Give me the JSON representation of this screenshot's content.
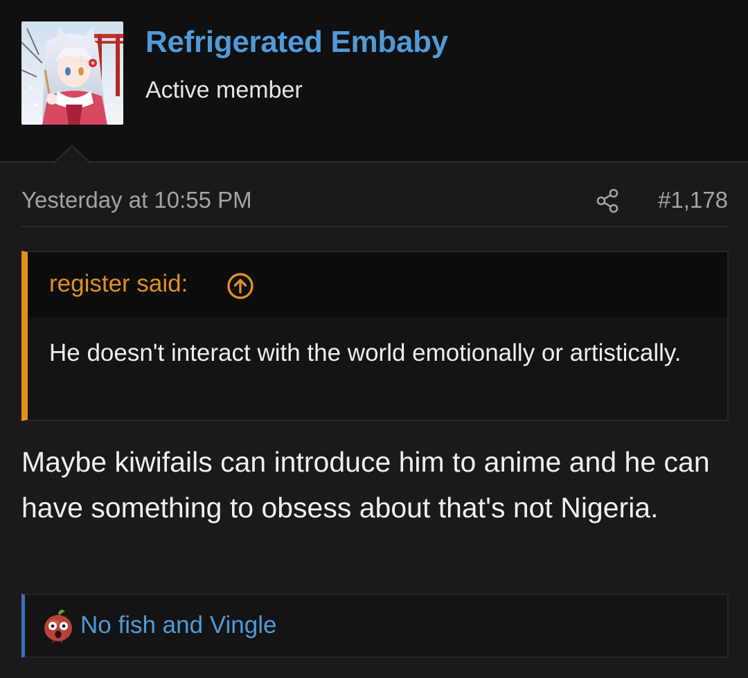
{
  "user": {
    "name": "Refrigerated Embaby",
    "title": "Active member"
  },
  "post": {
    "timestamp": "Yesterday at 10:55 PM",
    "number": "#1,178",
    "share_icon": "share-icon"
  },
  "quote": {
    "author_label": "register said:",
    "jump_icon": "arrow-up-circle-icon",
    "text": "He doesn't interact with the world emotionally or artistically."
  },
  "message": {
    "text": "Maybe kiwifails can introduce him to anime and he can have something to obsess about that's not Nigeria."
  },
  "reactions": {
    "icon": "shocked-face-reaction-icon",
    "text": "No fish and Vingle"
  },
  "colors": {
    "background": "#1a1a1a",
    "header_background": "#101010",
    "username": "#4f9bd9",
    "quote_accent": "#e0901f",
    "reaction_accent": "#3a73b8",
    "muted_text": "#a4a4a4"
  }
}
